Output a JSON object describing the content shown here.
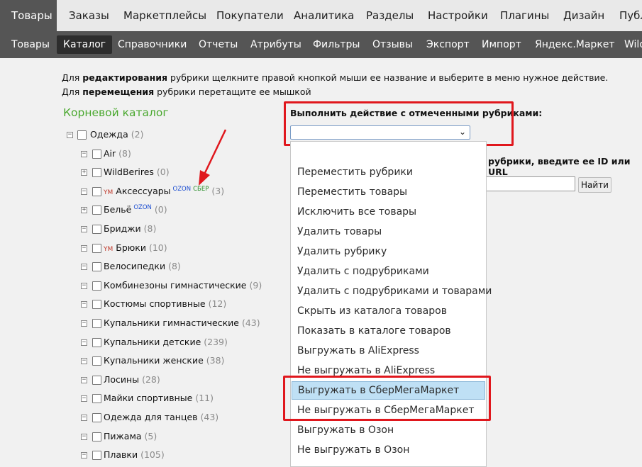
{
  "top_nav": [
    "Товары",
    "Заказы",
    "Маркетплейсы",
    "Покупатели",
    "Аналитика",
    "Разделы",
    "Настройки",
    "Плагины",
    "Дизайн",
    "Публ"
  ],
  "sub_nav": [
    "Товары",
    "Каталог",
    "Справочники",
    "Отчеты",
    "Атрибуты",
    "Фильтры",
    "Отзывы",
    "Экспорт",
    "Импорт",
    "Яндекс.Маркет",
    "Wild"
  ],
  "instructions": {
    "line1_pre": "Для ",
    "line1_bold": "редактирования",
    "line1_post": " рубрики щелкните правой кнопкой мыши ее название и выберите в меню нужное действие.",
    "line2_pre": "Для ",
    "line2_bold": "перемещения",
    "line2_post": " рубрики перетащите ее мышкой"
  },
  "root_title": "Корневой каталог",
  "tree": [
    {
      "label": "Одежда",
      "count": "(2)",
      "expander": "−",
      "ym": "",
      "ozon": "",
      "sber": ""
    },
    {
      "label": "Air",
      "count": "(8)",
      "expander": "−",
      "ym": "",
      "ozon": "",
      "sber": ""
    },
    {
      "label": "WildBerires",
      "count": "(0)",
      "expander": "+",
      "ym": "",
      "ozon": "",
      "sber": ""
    },
    {
      "label": "Аксессуары",
      "count": "(3)",
      "expander": "−",
      "ym": "YM",
      "ozon": "OZON",
      "sber": "СБЕР"
    },
    {
      "label": "Бельё",
      "count": "(0)",
      "expander": "+",
      "ym": "",
      "ozon": "OZON",
      "sber": ""
    },
    {
      "label": "Бриджи",
      "count": "(8)",
      "expander": "−",
      "ym": "",
      "ozon": "",
      "sber": ""
    },
    {
      "label": "Брюки",
      "count": "(10)",
      "expander": "−",
      "ym": "YM",
      "ozon": "",
      "sber": ""
    },
    {
      "label": "Велосипедки",
      "count": "(8)",
      "expander": "−",
      "ym": "",
      "ozon": "",
      "sber": ""
    },
    {
      "label": "Комбинезоны гимнастические",
      "count": "(9)",
      "expander": "−",
      "ym": "",
      "ozon": "",
      "sber": ""
    },
    {
      "label": "Костюмы спортивные",
      "count": "(12)",
      "expander": "−",
      "ym": "",
      "ozon": "",
      "sber": ""
    },
    {
      "label": "Купальники гимнастические",
      "count": "(43)",
      "expander": "−",
      "ym": "",
      "ozon": "",
      "sber": ""
    },
    {
      "label": "Купальники детские",
      "count": "(239)",
      "expander": "−",
      "ym": "",
      "ozon": "",
      "sber": ""
    },
    {
      "label": "Купальники женские",
      "count": "(38)",
      "expander": "−",
      "ym": "",
      "ozon": "",
      "sber": ""
    },
    {
      "label": "Лосины",
      "count": "(28)",
      "expander": "−",
      "ym": "",
      "ozon": "",
      "sber": ""
    },
    {
      "label": "Майки спортивные",
      "count": "(11)",
      "expander": "−",
      "ym": "",
      "ozon": "",
      "sber": ""
    },
    {
      "label": "Одежда для танцев",
      "count": "(43)",
      "expander": "−",
      "ym": "",
      "ozon": "",
      "sber": ""
    },
    {
      "label": "Пижама",
      "count": "(5)",
      "expander": "−",
      "ym": "",
      "ozon": "",
      "sber": ""
    },
    {
      "label": "Плавки",
      "count": "(105)",
      "expander": "−",
      "ym": "",
      "ozon": "",
      "sber": ""
    }
  ],
  "action": {
    "label": "Выполнить действие с отмеченными рубриками:",
    "selected_value": "",
    "options": [
      "Переместить рубрики",
      "Переместить товары",
      "Исключить все товары",
      "Удалить товары",
      "Удалить рубрику",
      "Удалить с подрубриками",
      "Удалить с подрубриками и товарами",
      "Скрыть из каталога товаров",
      "Показать в каталоге товаров",
      "Выгружать в AliExpress",
      "Не выгружать в AliExpress",
      "Выгружать в СберМегаМаркет",
      "Не выгружать в СберМегаМаркет",
      "Выгружать в Озон",
      "Не выгружать в Озон"
    ],
    "highlighted": "Выгружать в СберМегаМаркет"
  },
  "find": {
    "text": "рубрики, введите ее ID или URL",
    "button": "Найти",
    "value": ""
  },
  "colors": {
    "accent_green": "#4aa82f",
    "highlight_red": "#e0171d",
    "selection_blue": "#bfe0f5"
  }
}
